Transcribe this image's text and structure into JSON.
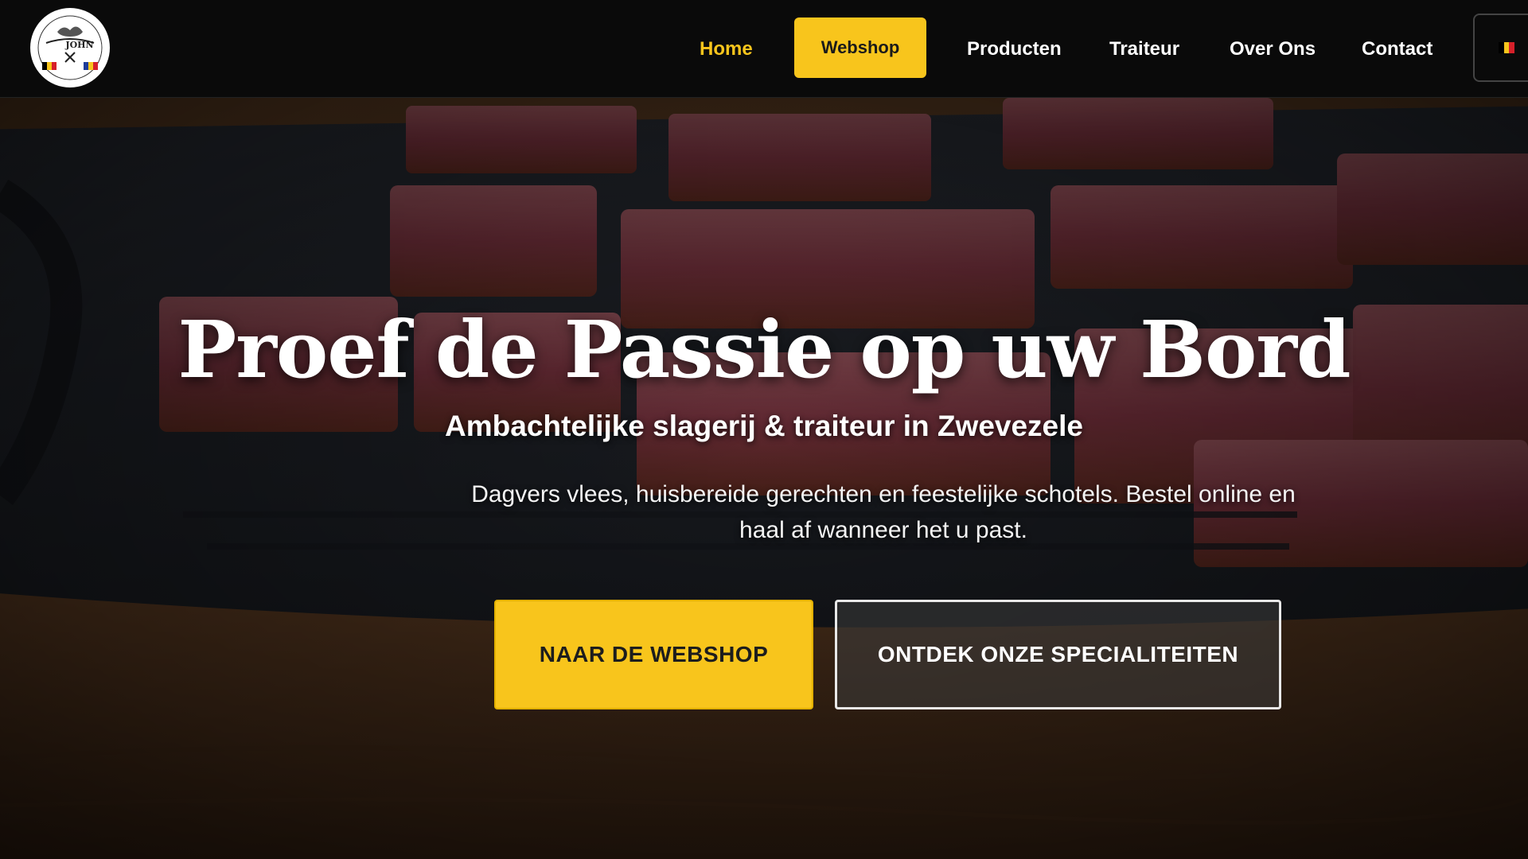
{
  "header": {
    "logo": {
      "icon": "butcher-logo-icon",
      "text": "JOHN"
    },
    "nav": {
      "home": "Home",
      "webshop": "Webshop",
      "producten": "Producten",
      "traiteur": "Traiteur",
      "over_ons": "Over Ons",
      "contact": "Contact"
    },
    "language": {
      "icon": "belgian-flag-icon"
    }
  },
  "hero": {
    "title": "Proef de Passie op uw Bord",
    "subtitle": "Ambachtelijke slagerij & traiteur in Zwevezele",
    "description": "Dagvers vlees, huisbereide gerechten en feestelijke schotels. Bestel online en haal af wanneer het u past.",
    "primary_cta": "NAAR DE WEBSHOP",
    "secondary_cta": "ONTDEK ONZE SPECIALITEITEN"
  },
  "colors": {
    "accent": "#f8c51c",
    "header_bg": "#0a0a0a",
    "text": "#ffffff"
  }
}
